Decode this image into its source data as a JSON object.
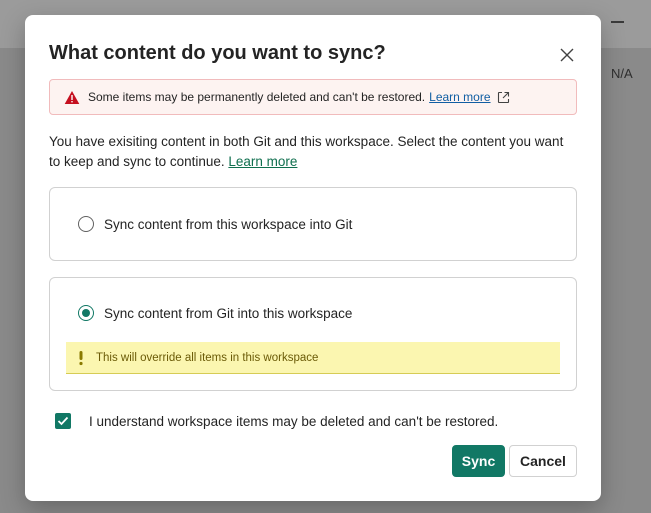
{
  "background": {
    "na_label": "N/A"
  },
  "dialog": {
    "title": "What content do you want to sync?",
    "warning": {
      "text": "Some items may be permanently deleted and can't be restored.",
      "link": "Learn more",
      "color": "#c50f1f"
    },
    "description": {
      "text": "You have exisiting content in both Git and this workspace. Select the content you want to keep and sync to continue.",
      "link": "Learn more"
    },
    "options": [
      {
        "label": "Sync content from this workspace into Git",
        "selected": false
      },
      {
        "label": "Sync content from Git into this workspace",
        "selected": true,
        "note": "This will override all items in this workspace"
      }
    ],
    "acknowledge": {
      "label": "I understand workspace items may be deleted and can't be restored.",
      "checked": true
    },
    "buttons": {
      "sync": "Sync",
      "cancel": "Cancel"
    },
    "accent_color": "#117865"
  }
}
